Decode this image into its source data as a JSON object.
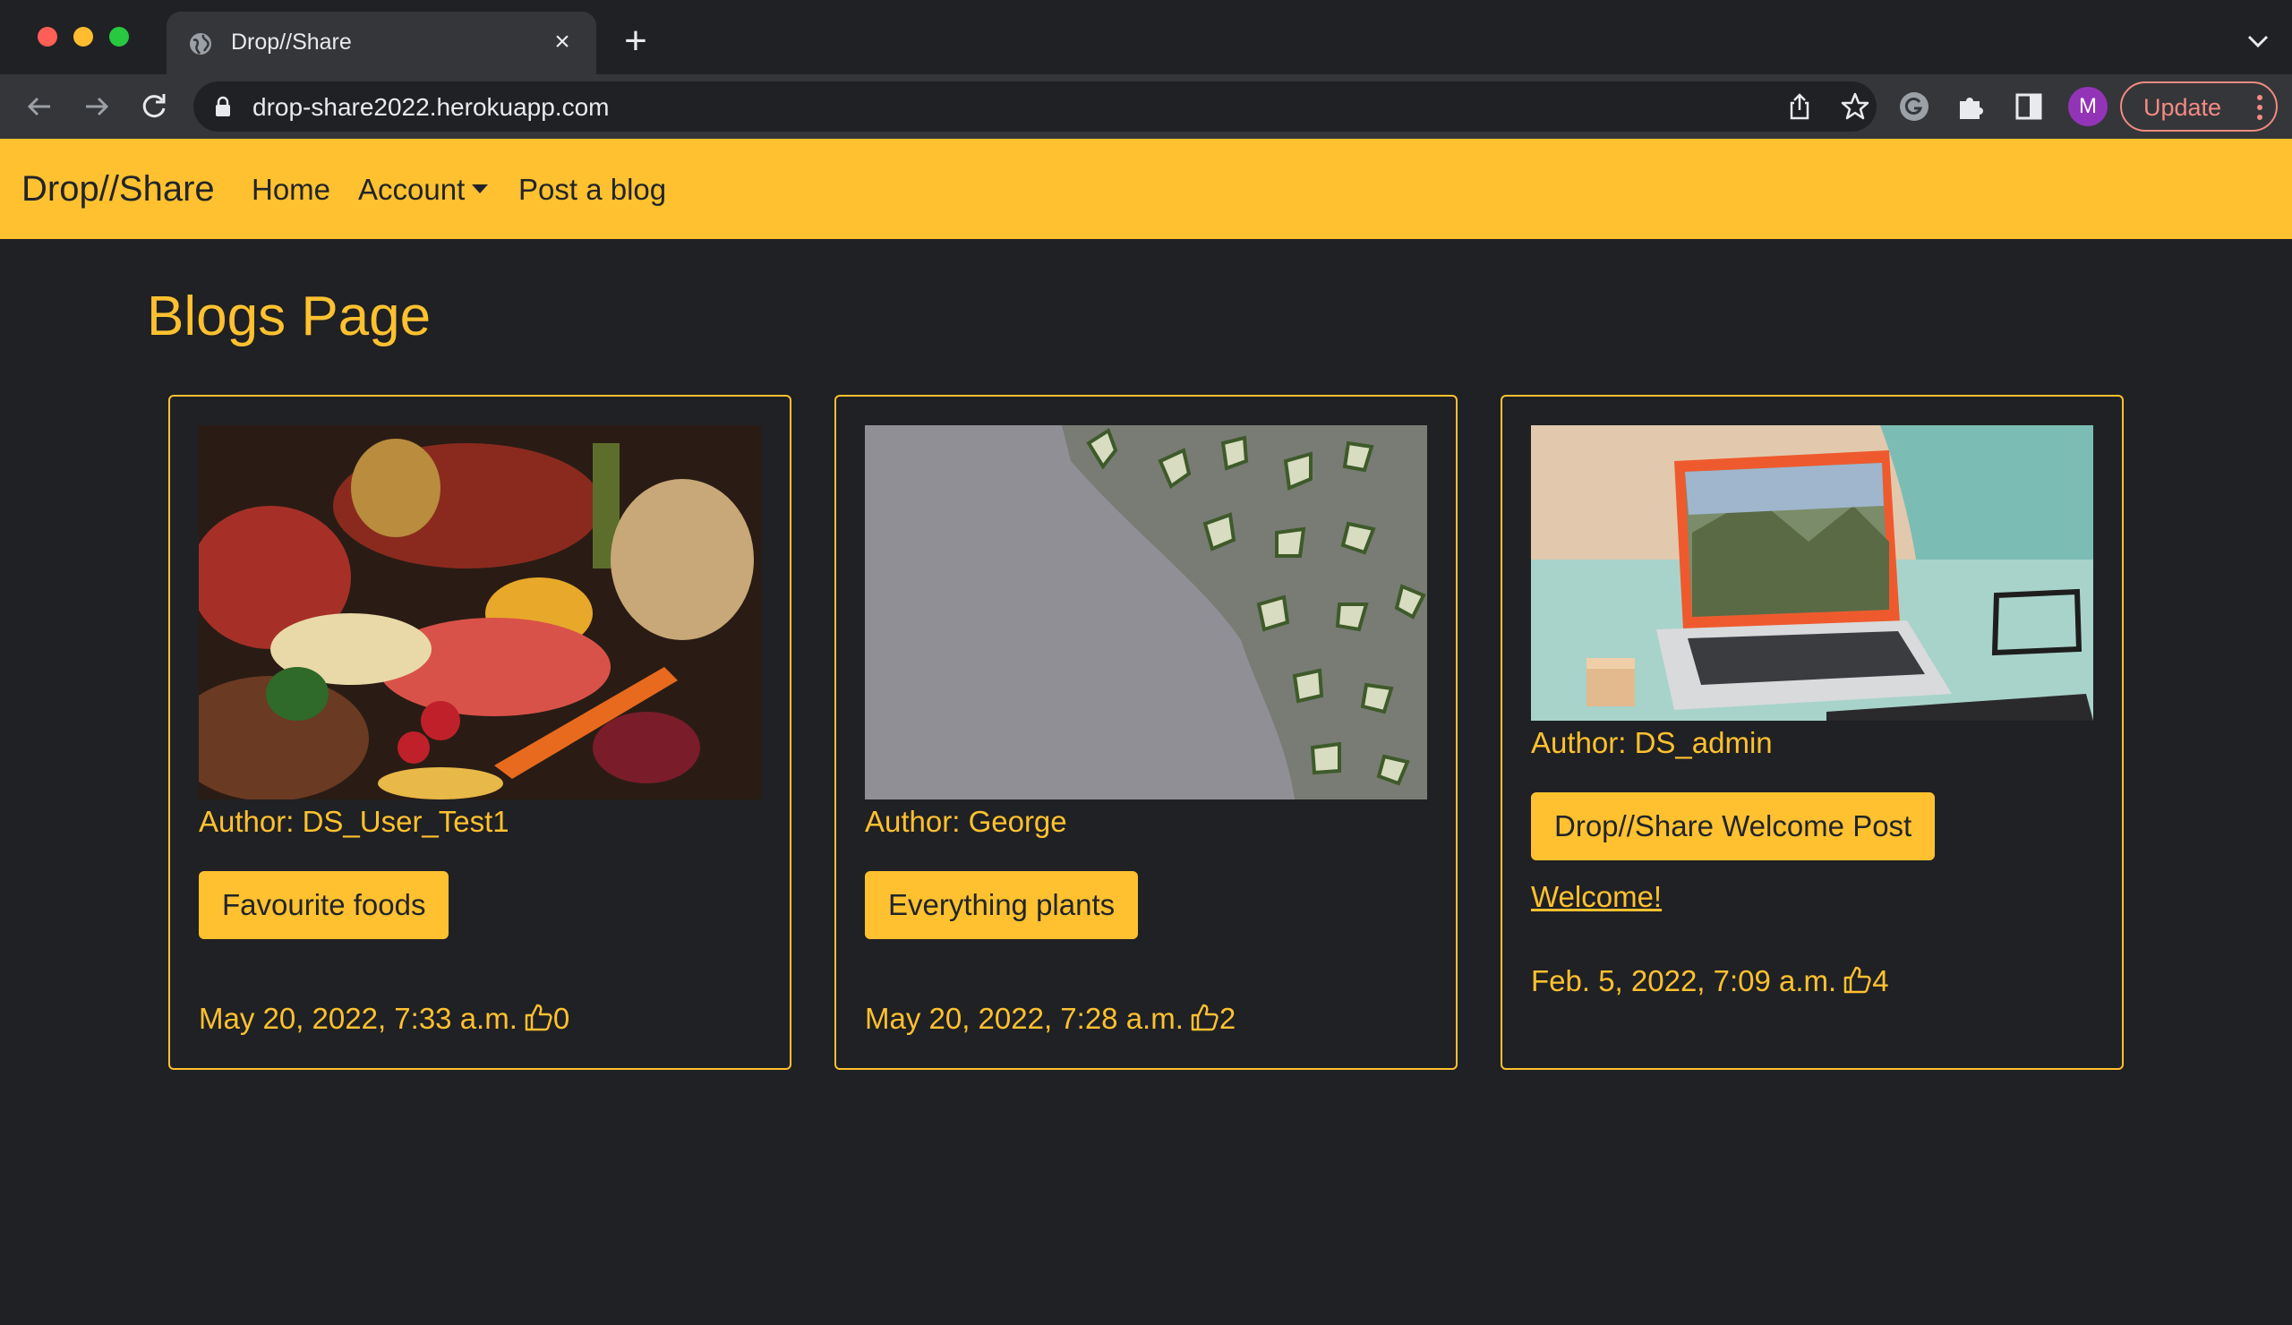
{
  "browser": {
    "tab_title": "Drop//Share",
    "tab_close": "×",
    "new_tab": "+",
    "url": "drop-share2022.herokuapp.com",
    "avatar_initial": "M",
    "update_label": "Update"
  },
  "navbar": {
    "brand": "Drop//Share",
    "links": {
      "home": "Home",
      "account": "Account",
      "post_blog": "Post a blog"
    }
  },
  "page": {
    "title": "Blogs Page"
  },
  "blogs": [
    {
      "author": "Author: DS_User_Test1",
      "title": "Favourite foods",
      "excerpt": "",
      "date": "May 20, 2022, 7:33 a.m.",
      "likes": "0",
      "image": "food-image"
    },
    {
      "author": "Author: George",
      "title": "Everything plants",
      "excerpt": "",
      "date": "May 20, 2022, 7:28 a.m.",
      "likes": "2",
      "image": "ivy-wall-image"
    },
    {
      "author": "Author: DS_admin",
      "title": "Drop//Share Welcome Post",
      "excerpt": "Welcome!",
      "date": "Feb. 5, 2022, 7:09 a.m.",
      "likes": "4",
      "image": "laptop-image"
    }
  ],
  "colors": {
    "accent": "#ffc12f",
    "background": "#202124",
    "update": "#f28b82"
  }
}
